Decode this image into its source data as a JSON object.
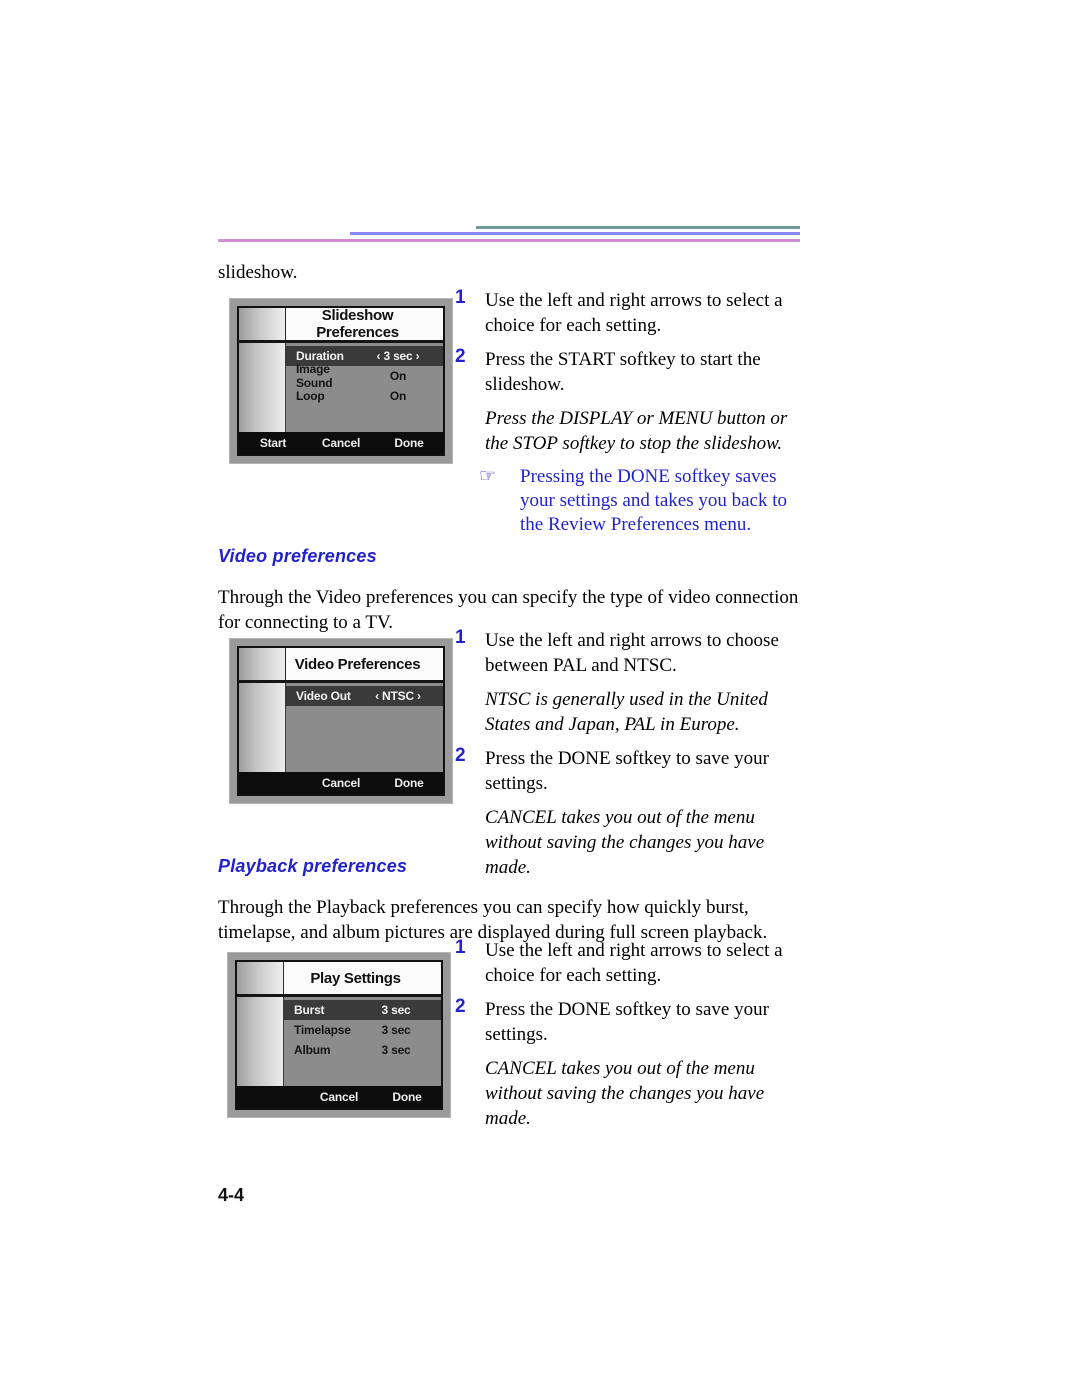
{
  "page": {
    "number": "4-4",
    "continued_line": "slideshow.",
    "rules": {
      "teal": "#6f9a97",
      "blue": "#8b87f5",
      "pink": "#cf8fd0"
    },
    "accent_color": "#2222cc"
  },
  "slideshow_section": {
    "steps": [
      {
        "num": "1",
        "text": "Use the left and right arrows to select a choice for each setting."
      },
      {
        "num": "2",
        "text": "Press the START softkey to start the slideshow."
      }
    ],
    "note_italic": "Press the DISPLAY or MENU button or the STOP softkey to stop the slideshow.",
    "tip_icon": "pointing-hand-icon",
    "tip_glyph": "☞",
    "tip_text": "Pressing the DONE softkey saves your settings and takes you back to the Review Preferences menu.",
    "screen": {
      "title": "Slideshow Preferences",
      "rows": [
        {
          "label": "Duration",
          "value": "‹ 3 sec ›",
          "selected": true
        },
        {
          "label": "Image Sound",
          "value": "On",
          "selected": false
        },
        {
          "label": "Loop",
          "value": "On",
          "selected": false
        }
      ],
      "softkeys": [
        "Start",
        "Cancel",
        "Done"
      ]
    }
  },
  "video_section": {
    "heading": "Video preferences",
    "intro": "Through the Video preferences you can specify the type of video connection for connecting to a TV.",
    "steps": [
      {
        "num": "1",
        "text": "Use the left and right arrows to choose between PAL and NTSC."
      },
      {
        "num": "2",
        "text": "Press the DONE softkey to save your settings."
      }
    ],
    "note_italic_1": "NTSC is generally used in the United States and Japan, PAL in Europe.",
    "note_italic_2": "CANCEL takes you out of the menu without saving the changes you have made.",
    "screen": {
      "title": "Video Preferences",
      "rows": [
        {
          "label": "Video Out",
          "value": "‹ NTSC ›",
          "selected": true
        }
      ],
      "softkeys": [
        "",
        "Cancel",
        "Done"
      ]
    }
  },
  "playback_section": {
    "heading": "Playback preferences",
    "intro": "Through the Playback preferences you can specify how quickly burst, timelapse, and album pictures are displayed during full screen playback.",
    "steps": [
      {
        "num": "1",
        "text": "Use the left and right arrows to select a choice for each setting."
      },
      {
        "num": "2",
        "text": "Press the DONE softkey to save your settings."
      }
    ],
    "note_italic": "CANCEL takes you out of the menu without saving the changes you have made.",
    "screen": {
      "title": "Play Settings",
      "rows": [
        {
          "label": "Burst",
          "value": "3 sec",
          "selected": true
        },
        {
          "label": "Timelapse",
          "value": "3 sec",
          "selected": false
        },
        {
          "label": "Album",
          "value": "3 sec",
          "selected": false
        }
      ],
      "softkeys": [
        "",
        "Cancel",
        "Done"
      ]
    }
  }
}
